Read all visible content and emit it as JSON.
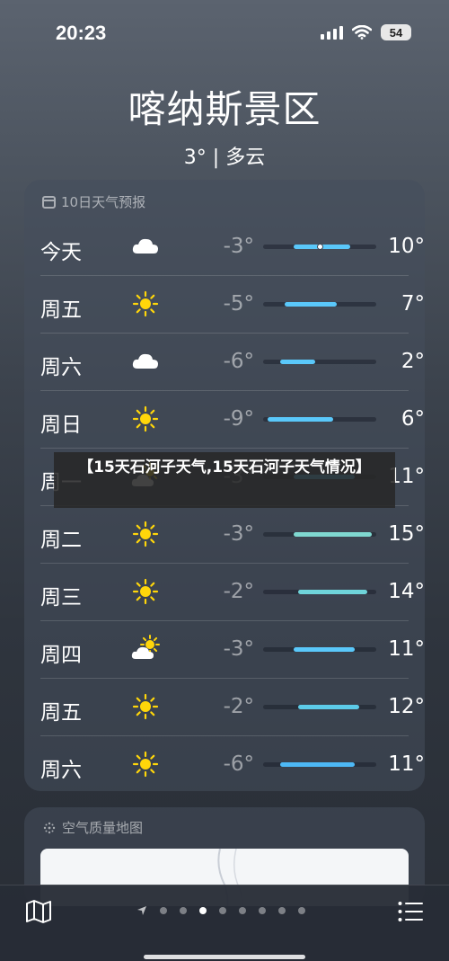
{
  "status_bar": {
    "time": "20:23",
    "battery": "54"
  },
  "location": {
    "name": "喀纳斯景区",
    "summary": "3°  |  多云"
  },
  "forecast": {
    "title": "10日天气预报",
    "scale": {
      "min": -10,
      "max": 16
    },
    "days": [
      {
        "name": "今天",
        "icon": "cloud-icon",
        "low": "-3°",
        "high": "10°",
        "low_val": -3,
        "high_val": 10,
        "current_val": 3,
        "color": "#5ac8fa"
      },
      {
        "name": "周五",
        "icon": "sun-icon",
        "low": "-5°",
        "high": "7°",
        "low_val": -5,
        "high_val": 7,
        "color": "#5ac8fa"
      },
      {
        "name": "周六",
        "icon": "cloud-icon",
        "low": "-6°",
        "high": "2°",
        "low_val": -6,
        "high_val": 2,
        "color": "#5ac8fa"
      },
      {
        "name": "周日",
        "icon": "sun-icon",
        "low": "-9°",
        "high": "6°",
        "low_val": -9,
        "high_val": 6,
        "color": "#5ac8fa"
      },
      {
        "name": "周一",
        "icon": "partly-cloudy-icon",
        "low": "-3°",
        "high": "11°",
        "low_val": -3,
        "high_val": 11,
        "color": "#5ac8fa"
      },
      {
        "name": "周二",
        "icon": "sun-icon",
        "low": "-3°",
        "high": "15°",
        "low_val": -3,
        "high_val": 15,
        "color": "#7fd8d0"
      },
      {
        "name": "周三",
        "icon": "sun-icon",
        "low": "-2°",
        "high": "14°",
        "low_val": -2,
        "high_val": 14,
        "color": "#6fd4da"
      },
      {
        "name": "周四",
        "icon": "partly-cloudy-icon",
        "low": "-3°",
        "high": "11°",
        "low_val": -3,
        "high_val": 11,
        "color": "#5ac8fa"
      },
      {
        "name": "周五",
        "icon": "sun-icon",
        "low": "-2°",
        "high": "12°",
        "low_val": -2,
        "high_val": 12,
        "color": "#5ccbe8"
      },
      {
        "name": "周六",
        "icon": "sun-icon",
        "low": "-6°",
        "high": "11°",
        "low_val": -6,
        "high_val": 11,
        "color": "#4db8f5"
      }
    ]
  },
  "air_quality": {
    "title": "空气质量地图"
  },
  "pager": {
    "count": 8,
    "active": 2
  },
  "overlay": {
    "text": "【15天石河子天气,15天石河子天气情况】"
  }
}
